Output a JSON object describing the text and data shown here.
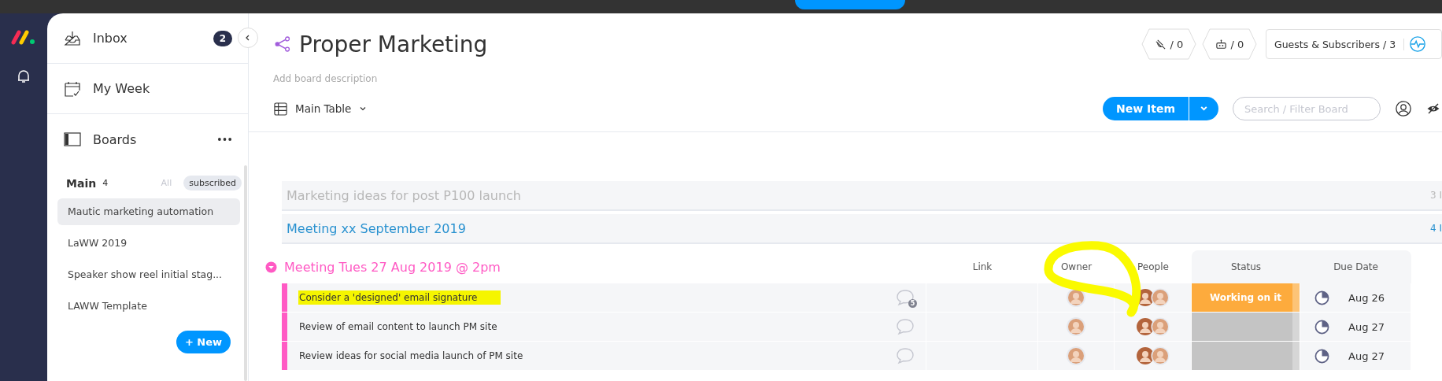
{
  "sidebar": {
    "items": [
      {
        "kind": "inbox",
        "label": "Inbox",
        "badge": "2"
      },
      {
        "kind": "week",
        "label": "My Week"
      },
      {
        "kind": "boards",
        "label": "Boards"
      }
    ],
    "workspace": {
      "name": "Main",
      "count": "4",
      "filters": [
        {
          "label": "All",
          "selected": false
        },
        {
          "label": "subscribed",
          "selected": true
        }
      ]
    },
    "boards": [
      {
        "name": "Mautic marketing automation",
        "selected": true
      },
      {
        "name": "LaWW 2019",
        "selected": false
      },
      {
        "name": "Speaker show reel initial stag...",
        "selected": false
      },
      {
        "name": "LAWW Template",
        "selected": false
      }
    ],
    "new_button": "+ New"
  },
  "board": {
    "title": "Proper Marketing",
    "description": {
      "placeholder": "Add board description"
    },
    "counters": [
      {
        "kind": "integrations",
        "value": "/ 0"
      },
      {
        "kind": "automations",
        "value": "/ 0"
      }
    ],
    "guests": "Guests & Subscribers / 3",
    "view": "Main Table",
    "new_item": "New Item",
    "search": {
      "placeholder": "Search / Filter Board"
    }
  },
  "groups": [
    {
      "title": "Marketing ideas for post P100 launch",
      "count": "3 I",
      "color": "#b8b8b8",
      "expanded": false
    },
    {
      "title": "Meeting xx September 2019",
      "count": "4 I",
      "color": "#2a92d0",
      "expanded": false
    },
    {
      "title": "Meeting Tues 27 Aug 2019 @ 2pm",
      "color": "#ff5ac4",
      "expanded": true,
      "columns": [
        "Link",
        "Owner",
        "People",
        "Status",
        "Due Date"
      ],
      "rows": [
        {
          "name": "Consider a 'designed' email signature",
          "highlighted": true,
          "comments": "5",
          "status": {
            "label": "Working on it",
            "color": "#fdab3d"
          },
          "due": "Aug 26"
        },
        {
          "name": "Review of email content to launch PM site",
          "highlighted": false,
          "status": {
            "color": "#c4c4c4"
          },
          "due": "Aug 27"
        },
        {
          "name": "Review ideas for social media launch of PM site",
          "highlighted": false,
          "status": {
            "color": "#c4c4c4"
          },
          "due": "Aug 27"
        }
      ]
    }
  ]
}
